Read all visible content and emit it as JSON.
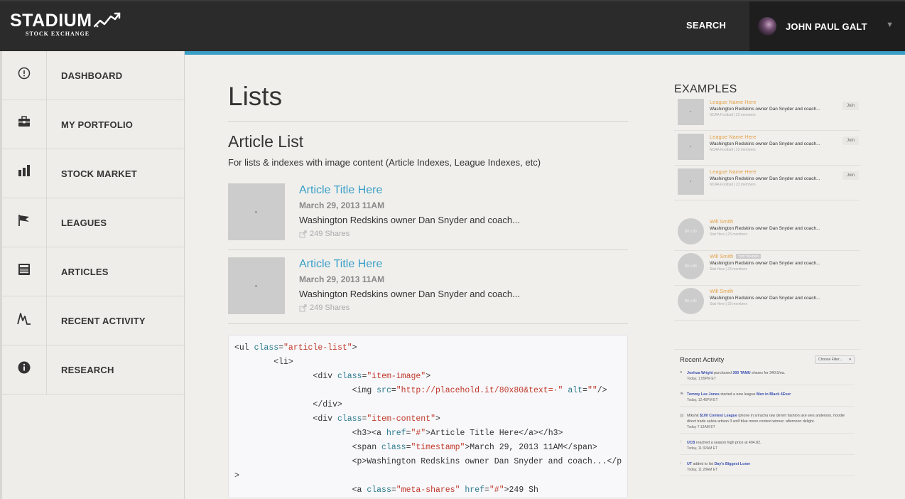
{
  "header": {
    "logo_main": "STADIUM",
    "logo_sub": "STOCK EXCHANGE",
    "search_label": "SEARCH",
    "user_name": "JOHN PAUL GALT",
    "user_caret": "▼"
  },
  "sidebar": {
    "items": [
      {
        "label": "DASHBOARD",
        "icon": "dashboard-icon"
      },
      {
        "label": "MY PORTFOLIO",
        "icon": "briefcase-icon"
      },
      {
        "label": "STOCK MARKET",
        "icon": "bar-chart-icon"
      },
      {
        "label": "LEAGUES",
        "icon": "flag-icon"
      },
      {
        "label": "ARTICLES",
        "icon": "newspaper-icon"
      },
      {
        "label": "RECENT ACTIVITY",
        "icon": "activity-icon"
      },
      {
        "label": "RESEARCH",
        "icon": "info-icon"
      }
    ]
  },
  "main": {
    "title": "Lists",
    "section_title": "Article List",
    "section_desc": "For lists & indexes with image content (Article Indexes, League Indexes, etc)",
    "articles": [
      {
        "title": "Article Title Here",
        "date": "March 29, 2013 11AM",
        "text": "Washington Redskins owner Dan Snyder and coach...",
        "shares": "249 Shares"
      },
      {
        "title": "Article Title Here",
        "date": "March 29, 2013 11AM",
        "text": "Washington Redskins owner Dan Snyder and coach...",
        "shares": "249 Shares"
      }
    ],
    "code_lines": [
      "<ul class=\"article-list\">",
      "        <li>",
      "                <div class=\"item-image\">",
      "                        <img src=\"http://placehold.it/80x80&text=·\" alt=\"\"/>",
      "                </div>",
      "                <div class=\"item-content\">",
      "                        <h3><a href=\"#\">Article Title Here</a></h3>",
      "                        <span class=\"timestamp\">March 29, 2013 11AM</span>",
      "                        <p>Washington Redskins owner Dan Snyder and coach...</p",
      ">",
      "                        <a class=\"meta-shares\" href=\"#\">249 Sh"
    ]
  },
  "examples": {
    "title": "EXAMPLES",
    "leagues": [
      {
        "name": "League Name Here",
        "desc": "Washington Redskins owner Dan Snyder and coach...",
        "meta": "NCAA Football | 23 members",
        "join": "Join"
      },
      {
        "name": "League Name Here",
        "desc": "Washington Redskins owner Dan Snyder and coach...",
        "meta": "NCAA Football | 23 members",
        "join": "Join"
      },
      {
        "name": "League Name Here",
        "desc": "Washington Redskins owner Dan Snyder and coach...",
        "meta": "NCAA Football | 23 members",
        "join": "Join"
      }
    ],
    "people": [
      {
        "name": "Will Smith",
        "badge": "",
        "desc": "Washington Redskins owner Dan Snyder and coach...",
        "meta": "Stat Here | 23 members",
        "thumb": "80 x 80"
      },
      {
        "name": "Will Smith",
        "badge": "TOP TRADER",
        "desc": "Washington Redskins owner Dan Snyder and coach...",
        "meta": "Stat Here | 23 members",
        "thumb": "80 x 80"
      },
      {
        "name": "Will Smith",
        "badge": "",
        "desc": "Washington Redskins owner Dan Snyder and coach...",
        "meta": "Stat Here | 23 members",
        "thumb": "80 x 80"
      }
    ],
    "activity": {
      "title": "Recent Activity",
      "filter": "Choose Filter...",
      "items": [
        {
          "icon": "user-icon",
          "link1": "Joshua Wright",
          "text1": " purchased ",
          "link2": "300 TAMU",
          "text2": " shares for 340.5/ea.",
          "time": "Today, 1:05PM ET"
        },
        {
          "icon": "flag-icon",
          "link1": "Tommy Lee Jones",
          "text1": " started a new league ",
          "link2": "Men in Black 4Ever",
          "text2": "",
          "time": "Today, 12:45PM ET"
        },
        {
          "icon": "newspaper-icon",
          "link1": "",
          "text1": "Mlkshk ",
          "link2": "$100 Contest League",
          "text2": " iphone in sriracha raw denim fashion axe wes anderson, hoodie direct trade salvia artisan 3 wolf blue moon contest winner; afternoon delight.",
          "time": "Today 7:13AM ET"
        },
        {
          "icon": "arrow-up-icon",
          "link1": "UCB",
          "text1": " reached a season high price at 404.82.",
          "link2": "",
          "text2": "",
          "time": "Today, 11:32AM ET"
        },
        {
          "icon": "arrow-down-icon",
          "link1": "UT",
          "text1": " added to list ",
          "link2": "Day's Biggest Loser",
          "text2": "",
          "time": "Today, 11:28AM ET"
        }
      ]
    }
  },
  "colors": {
    "accent": "#3a9fc7",
    "topbar": "#2b2b2b",
    "league_name": "#e5a24a",
    "activity_link": "#3b4fb0"
  }
}
